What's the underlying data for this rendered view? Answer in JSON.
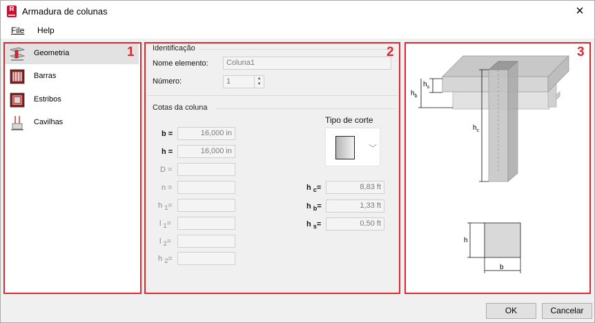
{
  "window": {
    "title": "Armadura de colunas",
    "app_icon": "R",
    "close": "×"
  },
  "menu": {
    "file": "File",
    "help": "Help"
  },
  "nav": [
    {
      "label": "Geometria",
      "icon": "geometry-icon"
    },
    {
      "label": "Barras",
      "icon": "bars-icon"
    },
    {
      "label": "Estribos",
      "icon": "stirrups-icon"
    },
    {
      "label": "Cavilhas",
      "icon": "dowels-icon"
    }
  ],
  "callouts": {
    "n1": "1",
    "n2": "2",
    "n3": "3"
  },
  "identification": {
    "title": "Identificação",
    "name_label": "Nome elemento:",
    "name_value": "Coluna1",
    "number_label": "Número:",
    "number_value": "1"
  },
  "dimensions": {
    "title": "Cotas da coluna",
    "cut_type_label": "Tipo de corte",
    "b_label": "b =",
    "b_value": "16,000 in",
    "h_label": "h =",
    "h_value": "16,000 in",
    "D_label": "D =",
    "n_label": "n =",
    "h1_label": "h",
    "h1_sub": "1",
    "h1_eq": "=",
    "l1_label": "l",
    "l1_sub": "1",
    "l1_eq": "=",
    "l2_label": "l",
    "l2_sub": "2",
    "l2_eq": "=",
    "h2_label": "h",
    "h2_sub": "2",
    "h2_eq": "=",
    "hc_label": "h",
    "hc_sub": "c",
    "hc_eq": "=",
    "hc_value": "8,83 ft",
    "hb_label": "h",
    "hb_sub": "b",
    "hb_eq": "=",
    "hb_value": "1,33 ft",
    "hs_label": "h",
    "hs_sub": "s",
    "hs_eq": "=",
    "hs_value": "0,50 ft"
  },
  "preview": {
    "hs": "h",
    "hs_sub": "s",
    "hb": "h",
    "hb_sub": "b",
    "hc": "h",
    "hc_sub": "c",
    "h": "h",
    "b": "b"
  },
  "buttons": {
    "ok": "OK",
    "cancel": "Cancelar"
  },
  "colors": {
    "callout_red": "#e0262e",
    "selected_bg": "#e2e2e2"
  }
}
